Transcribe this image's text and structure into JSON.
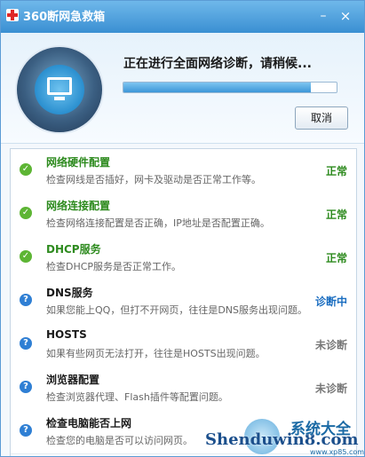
{
  "window": {
    "title": "360断网急救箱",
    "minimize_label": "–",
    "close_label": "×"
  },
  "header": {
    "status_text": "正在进行全面网络诊断，请稍候...",
    "progress_fraction": 0.88,
    "cancel_label": "取消"
  },
  "checks": [
    {
      "title": "网络硬件配置",
      "desc": "检查网线是否插好，网卡及驱动是否正常工作等。",
      "status": "正常",
      "state": "done"
    },
    {
      "title": "网络连接配置",
      "desc": "检查网络连接配置是否正确，IP地址是否配置正确。",
      "status": "正常",
      "state": "done"
    },
    {
      "title": "DHCP服务",
      "desc": "检查DHCP服务是否正常工作。",
      "status": "正常",
      "state": "done"
    },
    {
      "title": "DNS服务",
      "desc": "如果您能上QQ，但打不开网页，往往是DNS服务出现问题。",
      "status": "诊断中",
      "state": "active"
    },
    {
      "title": "HOSTS",
      "desc": "如果有些网页无法打开，往往是HOSTS出现问题。",
      "status": "未诊断",
      "state": "pending"
    },
    {
      "title": "浏览器配置",
      "desc": "检查浏览器代理、Flash插件等配置问题。",
      "status": "未诊断",
      "state": "pending"
    },
    {
      "title": "检查电脑能否上网",
      "desc": "检查您的电脑是否可以访问网页。",
      "status": "",
      "state": "pending"
    }
  ],
  "watermark": {
    "text": "Shenduwin8.com",
    "cn": "系统大全",
    "url": "www.xp85.com"
  },
  "colors": {
    "titlebar": "#3a8fd2",
    "ok_green": "#2e8b1f",
    "active_blue": "#1a6dc0",
    "pending_gray": "#777777"
  }
}
